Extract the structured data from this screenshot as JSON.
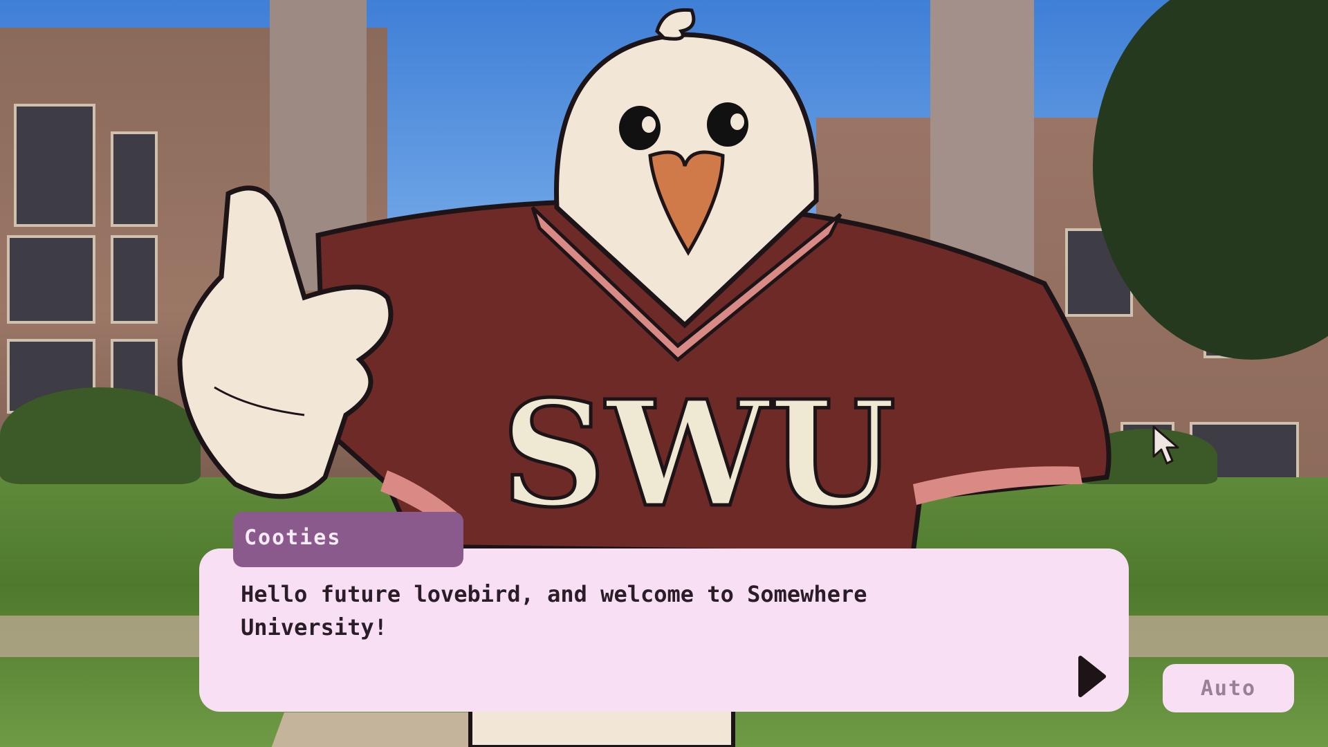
{
  "scene": {
    "background": "campus-courtyard",
    "character": "cooties-mascot",
    "shirt_text": "SWU",
    "colors": {
      "shirt": "#6e2a26",
      "trim": "#d98a84",
      "feather": "#f2e6d6",
      "beak": "#d07a4a"
    }
  },
  "dialogue": {
    "speaker": "Cooties",
    "text": "Hello future lovebird, and welcome to Somewhere University!",
    "advance_icon": "play-arrow-icon",
    "colors": {
      "box": "#f8dff4",
      "namebox": "#8b5a8c",
      "text": "#2a1d28"
    }
  },
  "controls": {
    "auto_label": "Auto"
  }
}
